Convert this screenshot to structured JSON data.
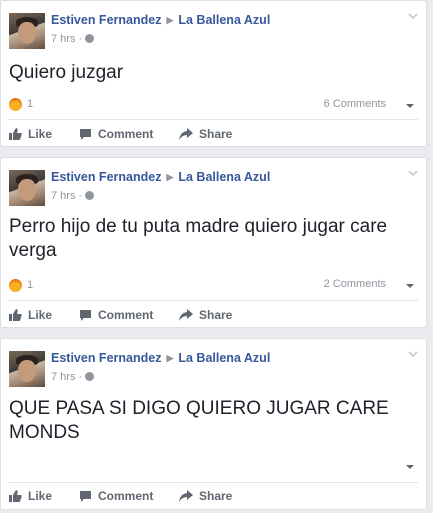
{
  "posts": [
    {
      "author": "Estiven Fernandez",
      "group": "La Ballena Azul",
      "time": "7 hrs",
      "text": "Quiero juzgar",
      "reaction_count": "1",
      "comments": "6 Comments"
    },
    {
      "author": "Estiven Fernandez",
      "group": "La Ballena Azul",
      "time": "7 hrs",
      "text": "Perro hijo de tu puta madre quiero jugar care verga",
      "reaction_count": "1",
      "comments": "2 Comments"
    },
    {
      "author": "Estiven Fernandez",
      "group": "La Ballena Azul",
      "time": "7 hrs",
      "text": "QUE PASA SI DIGO QUIERO JUGAR CARE MONDS",
      "reaction_count": "",
      "comments": ""
    }
  ],
  "actions": {
    "like": "Like",
    "comment": "Comment",
    "share": "Share"
  },
  "icons": {
    "reaction": "angry-reaction-icon",
    "like": "thumbs-up-icon",
    "comment": "speech-bubble-icon",
    "share": "share-arrow-icon",
    "audience": "globe-icon"
  }
}
